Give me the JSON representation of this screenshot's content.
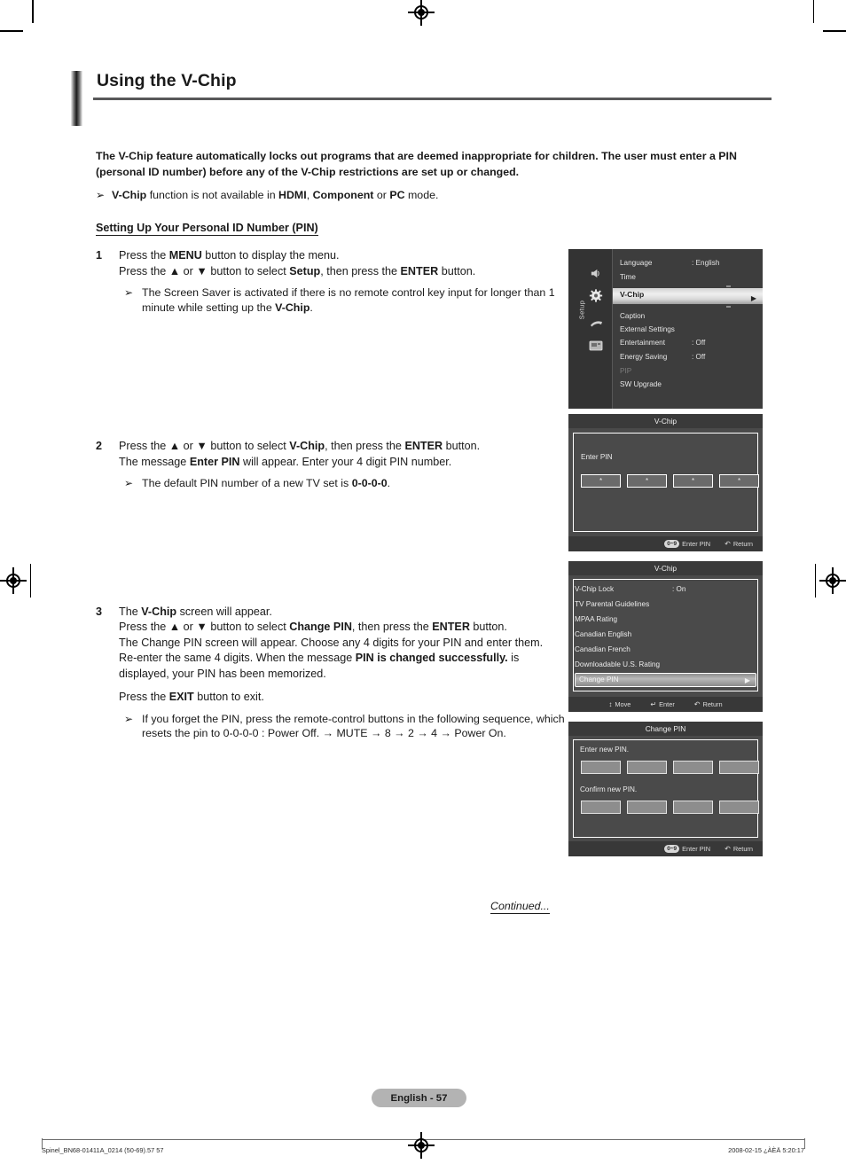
{
  "document": {
    "title": "Using the V-Chip",
    "page_badge": "English - 57",
    "continued": "Continued...",
    "footer_left": "Spinel_BN68-01411A_0214 (50-69).57   57",
    "footer_right": "2008-02-15   ¿ÀÈÄ 5:20:17"
  },
  "intro": {
    "paragraph": "The V-Chip feature automatically locks out programs that are deemed inappropriate for children. The user must enter a PIN (personal ID number) before any of the V-Chip restrictions are set up or changed.",
    "note_icon": "arrow-bullet-icon",
    "note": "V-Chip function is not available in HDMI, Component or PC mode."
  },
  "section": {
    "heading": "Setting Up Your Personal ID Number (PIN)"
  },
  "steps": [
    {
      "num": "1",
      "lines": [
        "Press the MENU button to display the menu.",
        "Press the ▲ or ▼ button to select Setup, then press the ENTER button."
      ],
      "note": "The Screen Saver is activated if there is no remote control key input for longer than 1 minute while setting up the V-Chip."
    },
    {
      "num": "2",
      "lines": [
        "Press the ▲ or ▼ button to select V-Chip, then press the ENTER button.",
        "The message Enter PIN will appear. Enter your 4 digit PIN number."
      ],
      "note": "The default PIN number of a new TV set is 0-0-0-0."
    },
    {
      "num": "3",
      "lines": [
        "The V-Chip screen will appear.",
        "Press the ▲ or ▼ button to select Change PIN, then press the ENTER button.",
        "The Change PIN screen will appear. Choose any 4 digits for your PIN and enter them. Re-enter the same 4 digits. When the message PIN is changed successfully. is displayed, your PIN has been memorized."
      ],
      "exit_line": "Press the EXIT button to exit.",
      "note": "If you forget the PIN, press the remote-control buttons in the following sequence, which resets the pin to 0-0-0-0 : Power Off. → MUTE → 8 → 2 → 4 → Power On."
    }
  ],
  "osd_setup_menu": {
    "rail_label": "Setup",
    "rail_icons": [
      "speaker-icon",
      "gear-icon",
      "hand-remote-icon",
      "input-source-icon"
    ],
    "selected_rail_index": 1,
    "items": [
      {
        "label": "Language",
        "value": ": English",
        "state": "normal"
      },
      {
        "label": "Time",
        "value": "",
        "state": "normal"
      },
      {
        "label": "V-Chip",
        "value": "",
        "state": "highlighted",
        "arrow": "▶"
      },
      {
        "label": "Caption",
        "value": "",
        "state": "normal"
      },
      {
        "label": "External Settings",
        "value": "",
        "state": "normal"
      },
      {
        "label": "Entertainment",
        "value": ": Off",
        "state": "normal"
      },
      {
        "label": "Energy Saving",
        "value": ": Off",
        "state": "normal"
      },
      {
        "label": "PIP",
        "value": "",
        "state": "disabled"
      },
      {
        "label": "SW Upgrade",
        "value": "",
        "state": "normal"
      }
    ]
  },
  "osd_enter_pin": {
    "title": "V-Chip",
    "prompt": "Enter PIN",
    "pin_digits": [
      "*",
      "*",
      "*",
      "*"
    ],
    "footer": [
      {
        "key": "0~9",
        "label": "Enter PIN",
        "icon": "numeric-key-icon"
      },
      {
        "key": "",
        "label": "Return",
        "icon": "return-arrow-icon"
      }
    ]
  },
  "osd_vchip_menu": {
    "title": "V-Chip",
    "items": [
      {
        "label": "V-Chip Lock",
        "value": ": On",
        "state": "normal"
      },
      {
        "label": "TV Parental Guidelines",
        "value": "",
        "state": "normal"
      },
      {
        "label": "MPAA Rating",
        "value": "",
        "state": "normal"
      },
      {
        "label": "Canadian English",
        "value": "",
        "state": "normal"
      },
      {
        "label": "Canadian French",
        "value": "",
        "state": "normal"
      },
      {
        "label": "Downloadable U.S. Rating",
        "value": "",
        "state": "normal"
      },
      {
        "label": "Change PIN",
        "value": "",
        "state": "highlighted",
        "arrow": "▶"
      }
    ],
    "footer": [
      {
        "key": "",
        "label": "Move",
        "icon": "updown-arrow-icon"
      },
      {
        "key": "",
        "label": "Enter",
        "icon": "enter-key-icon"
      },
      {
        "key": "",
        "label": "Return",
        "icon": "return-arrow-icon"
      }
    ]
  },
  "osd_change_pin": {
    "title": "Change PIN",
    "prompt_new": "Enter new PIN.",
    "prompt_confirm": "Confirm new PIN.",
    "boxes_new": [
      "",
      "",
      "",
      ""
    ],
    "boxes_confirm": [
      "",
      "",
      "",
      ""
    ],
    "footer": [
      {
        "key": "0~9",
        "label": "Enter PIN",
        "icon": "numeric-key-icon"
      },
      {
        "key": "",
        "label": "Return",
        "icon": "return-arrow-icon"
      }
    ]
  },
  "icons": {
    "bullet": "➢",
    "arrow_right": "▶",
    "return": "↺",
    "move": "↕",
    "enter": "↵"
  }
}
